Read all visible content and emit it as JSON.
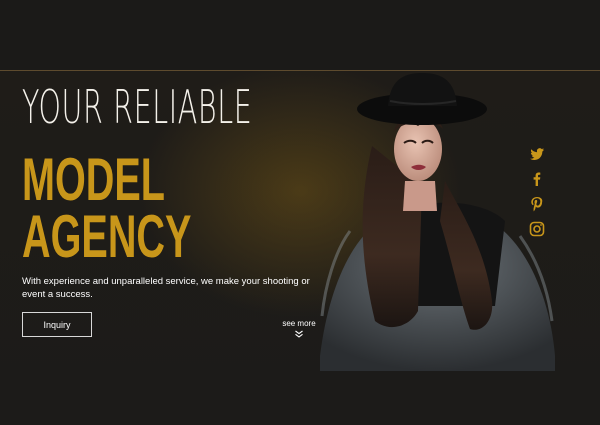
{
  "hero": {
    "headline_line1": "YOUR RELIABLE",
    "headline_line2": "MODEL",
    "headline_line3": "AGENCY",
    "tagline": "With experience and unparalleled service, we make your shooting or event a success.",
    "inquiry_label": "Inquiry",
    "see_more_label": "see more"
  },
  "social": [
    "twitter-icon",
    "facebook-icon",
    "pinterest-icon",
    "instagram-icon"
  ],
  "colors": {
    "background": "#1d1b19",
    "accent": "#c8961a",
    "divider": "#5e4b2e",
    "text": "#ffffff"
  }
}
